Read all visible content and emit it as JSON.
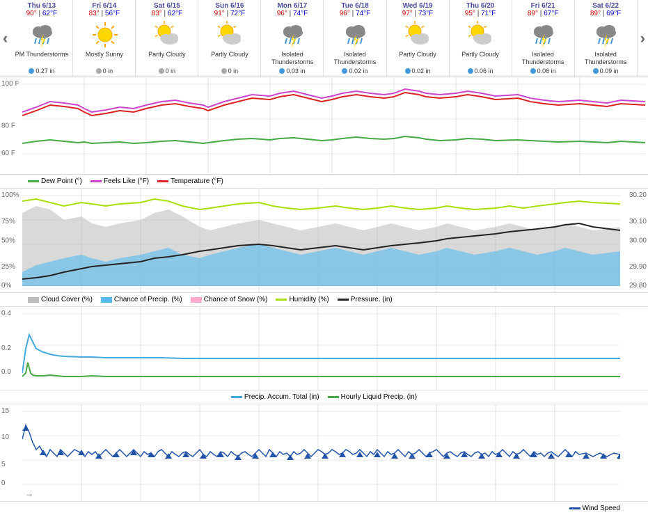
{
  "nav": {
    "left_arrow": "‹",
    "right_arrow": "›"
  },
  "days": [
    {
      "name": "Thu 6/13",
      "high": "90°",
      "low": "62°F",
      "icon": "thunderstorm",
      "desc": "PM Thunderstorms",
      "precip": "0.27 in",
      "precip_color": "blue"
    },
    {
      "name": "Fri 6/14",
      "high": "83°",
      "low": "56°F",
      "icon": "sunny",
      "desc": "Mostly Sunny",
      "precip": "0 in",
      "precip_color": "gray"
    },
    {
      "name": "Sat 6/15",
      "high": "83°",
      "low": "62°F",
      "icon": "partly_cloudy",
      "desc": "Partly Cloudy",
      "precip": "0 in",
      "precip_color": "gray"
    },
    {
      "name": "Sun 6/16",
      "high": "91°",
      "low": "72°F",
      "icon": "partly_cloudy",
      "desc": "Partly Cloudy",
      "precip": "0 in",
      "precip_color": "gray"
    },
    {
      "name": "Mon 6/17",
      "high": "96°",
      "low": "74°F",
      "icon": "thunderstorm",
      "desc": "Isolated Thunderstorms",
      "precip": "0.03 in",
      "precip_color": "blue"
    },
    {
      "name": "Tue 6/18",
      "high": "96°",
      "low": "74°F",
      "icon": "thunderstorm",
      "desc": "Isolated Thunderstorms",
      "precip": "0.02 in",
      "precip_color": "blue"
    },
    {
      "name": "Wed 6/19",
      "high": "97°",
      "low": "73°F",
      "icon": "partly_cloudy",
      "desc": "Partly Cloudy",
      "precip": "0.02 in",
      "precip_color": "blue"
    },
    {
      "name": "Thu 6/20",
      "high": "95°",
      "low": "71°F",
      "icon": "partly_cloudy",
      "desc": "Partly Cloudy",
      "precip": "0.06 in",
      "precip_color": "blue"
    },
    {
      "name": "Fri 6/21",
      "high": "89°",
      "low": "67°F",
      "icon": "thunderstorm",
      "desc": "Isolated Thunderstorms",
      "precip": "0.06 in",
      "precip_color": "blue"
    },
    {
      "name": "Sat 6/22",
      "high": "89°",
      "low": "69°F",
      "icon": "thunderstorm",
      "desc": "Isolated Thunderstorms",
      "precip": "0.09 in",
      "precip_color": "blue"
    }
  ],
  "chart1": {
    "y_labels": [
      "100 F",
      "80 F",
      "60 F"
    ],
    "legend": [
      {
        "label": "Dew Point (°)",
        "color": "#44aa44",
        "type": "line"
      },
      {
        "label": "Feels Like (°F)",
        "color": "#cc44cc",
        "type": "line"
      },
      {
        "label": "Temperature (°F)",
        "color": "#dd2222",
        "type": "line"
      }
    ]
  },
  "chart2": {
    "y_labels_left": [
      "100%",
      "75%",
      "50%",
      "25%",
      "0%"
    ],
    "y_labels_right": [
      "30.20",
      "30.10",
      "30.00",
      "29.90",
      "29.80"
    ],
    "legend": [
      {
        "label": "Cloud Cover (%)",
        "color": "#bbbbbb",
        "type": "area"
      },
      {
        "label": "Chance of Precip. (%)",
        "color": "#55bbee",
        "type": "area"
      },
      {
        "label": "Chance of Snow (%)",
        "color": "#ffaacc",
        "type": "area"
      },
      {
        "label": "Humidity (%)",
        "color": "#aadd00",
        "type": "line"
      },
      {
        "label": "Pressure. (in)",
        "color": "#222222",
        "type": "line"
      }
    ]
  },
  "chart3": {
    "y_labels": [
      "0.4",
      "0.2",
      "0.0"
    ],
    "legend": [
      {
        "label": "Precip. Accum. Total (in)",
        "color": "#44aadd",
        "type": "line"
      },
      {
        "label": "Hourly Liquid Precip. (in)",
        "color": "#44aa44",
        "type": "line"
      }
    ]
  },
  "chart4": {
    "y_labels": [
      "15",
      "10",
      "5",
      "0"
    ],
    "legend": [
      {
        "label": "Wind Speed",
        "color": "#2255aa",
        "type": "arrow"
      }
    ]
  }
}
